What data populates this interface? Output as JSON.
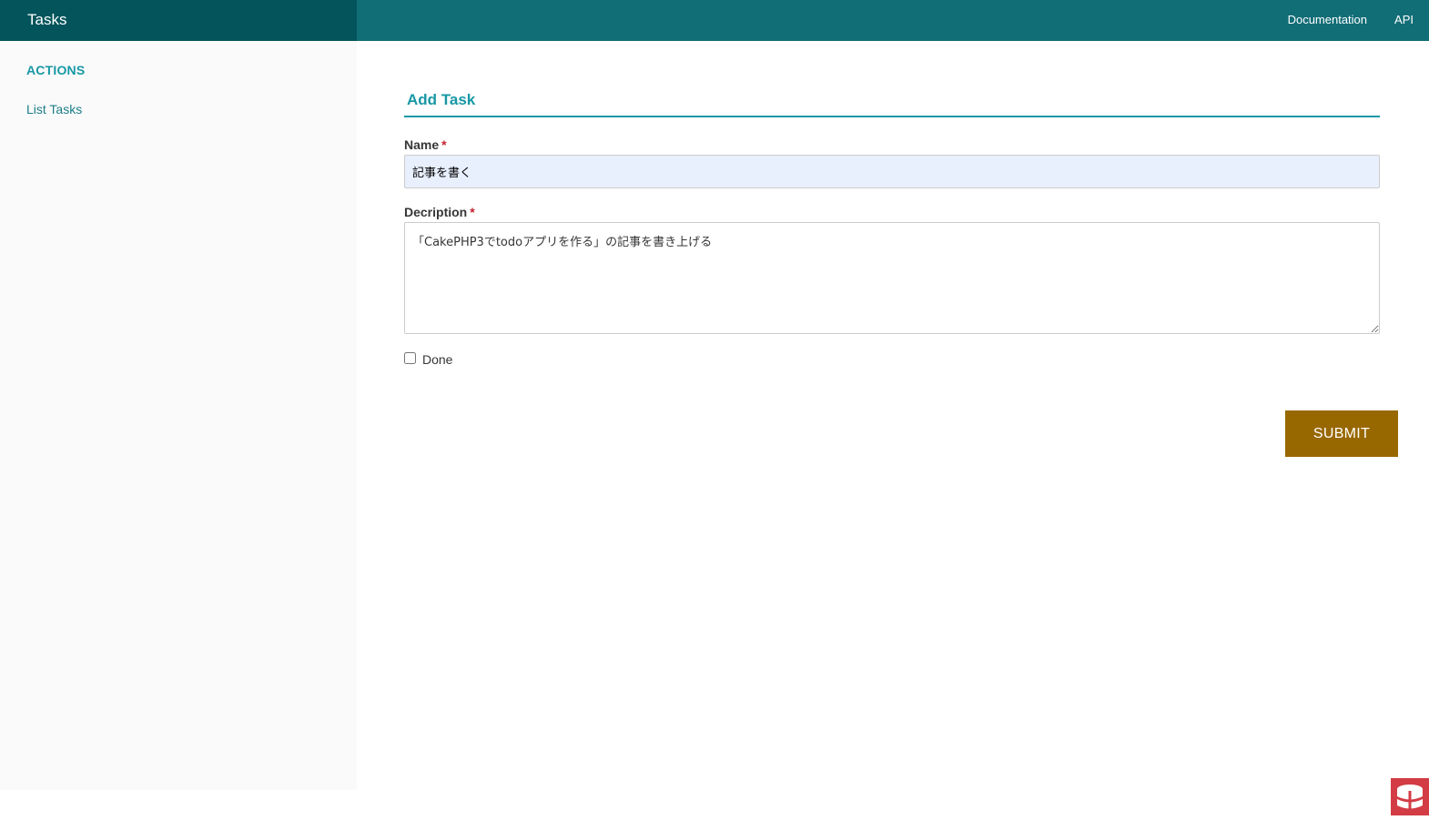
{
  "header": {
    "title": "Tasks",
    "links": [
      "Documentation",
      "API"
    ]
  },
  "sidebar": {
    "heading": "ACTIONS",
    "items": [
      {
        "label": "List Tasks"
      }
    ]
  },
  "form": {
    "legend": "Add Task",
    "name_label": "Name",
    "name_value": "記事を書く",
    "description_label": "Decription",
    "description_value": "「CakePHP3でtodoアプリを作る」の記事を書き上げる",
    "required_mark": "*",
    "done_label": "Done",
    "done_checked": false,
    "submit_label": "SUBMIT"
  },
  "colors": {
    "header_bg": "#116d76",
    "brand_bg": "#03545b",
    "accent": "#1798a5",
    "submit_bg": "#986800",
    "logo_bg": "#d33c44"
  },
  "icons": {
    "footer_logo": "cakephp-logo-icon"
  }
}
